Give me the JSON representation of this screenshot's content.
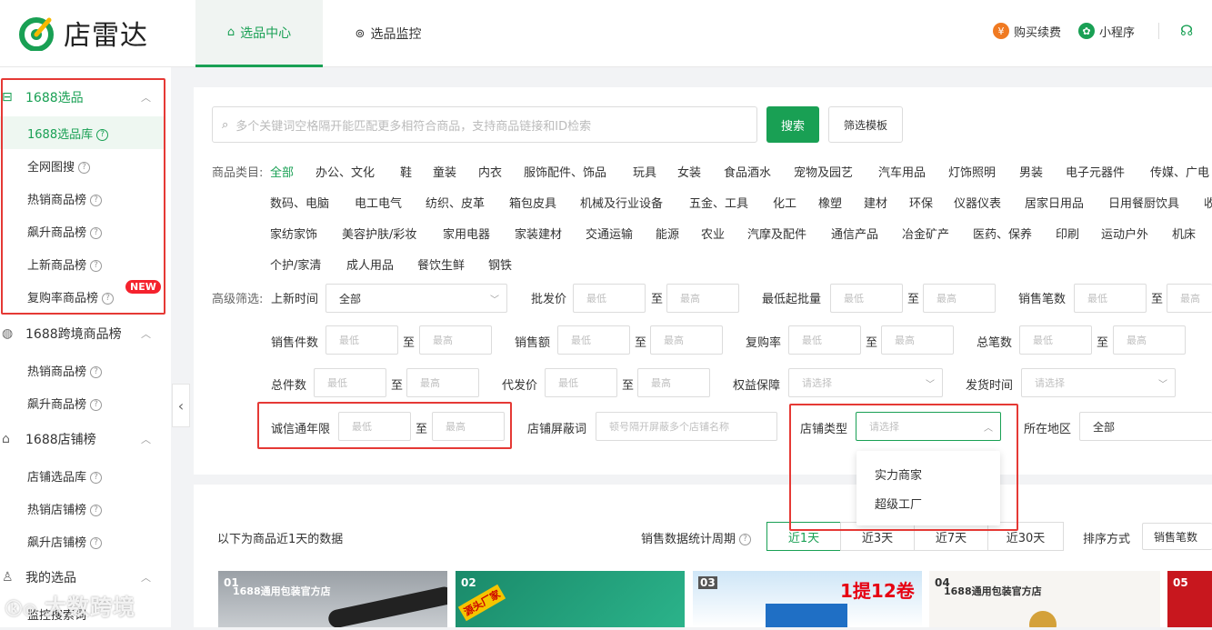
{
  "brand": {
    "name": "店雷达",
    "color": "#19a054"
  },
  "topnav": {
    "tab1": "选品中心",
    "tab2": "选品监控",
    "buy": "购买续费",
    "mini": "小程序"
  },
  "sidebar": {
    "g1": "1688选品",
    "g1_items": [
      "1688选品库",
      "全网图搜",
      "热销商品榜",
      "飙升商品榜",
      "上新商品榜",
      "复购率商品榜"
    ],
    "new_badge": "NEW",
    "g2": "1688跨境商品榜",
    "g2_items": [
      "热销商品榜",
      "飙升商品榜"
    ],
    "g3": "1688店铺榜",
    "g3_items": [
      "店铺选品库",
      "热销店铺榜",
      "飙升店铺榜"
    ],
    "g4": "我的选品",
    "g4_items": [
      "监控搜索词"
    ]
  },
  "search": {
    "placeholder": "多个关键词空格隔开能匹配更多相符合商品，支持商品链接和ID检索",
    "button": "搜索",
    "template": "筛选模板"
  },
  "categories": {
    "label": "商品类目:",
    "all": "全部",
    "row1": [
      "办公、文化",
      "鞋",
      "童装",
      "内衣",
      "服饰配件、饰品",
      "玩具",
      "女装",
      "食品酒水",
      "宠物及园艺",
      "汽车用品",
      "灯饰照明",
      "男装",
      "电子元器件",
      "传媒、广电"
    ],
    "row2": [
      "数码、电脑",
      "电工电气",
      "纺织、皮革",
      "箱包皮具",
      "机械及行业设备",
      "五金、工具",
      "化工",
      "橡塑",
      "建材",
      "环保",
      "仪器仪表",
      "居家日用品",
      "日用餐厨饮具",
      "收"
    ],
    "row3": [
      "家纺家饰",
      "美容护肤/彩妆",
      "家用电器",
      "家装建材",
      "交通运输",
      "能源",
      "农业",
      "汽摩及配件",
      "通信产品",
      "冶金矿产",
      "医药、保养",
      "印刷",
      "运动户外",
      "机床"
    ],
    "row4": [
      "个护/家清",
      "成人用品",
      "餐饮生鲜",
      "钢铁"
    ]
  },
  "filters": {
    "label": "高级筛选:",
    "to": "至",
    "min": "最低",
    "max": "最高",
    "all": "全部",
    "select": "请选择",
    "new_time": "上新时间",
    "wholesale_price": "批发价",
    "min_order": "最低起批量",
    "sales_count": "销售笔数",
    "sales_pieces": "销售件数",
    "sales_amount": "销售额",
    "repurchase": "复购率",
    "total_orders": "总笔数",
    "total_pieces": "总件数",
    "dropship_price": "代发价",
    "rights": "权益保障",
    "ship_time": "发货时间",
    "credit_years": "诚信通年限",
    "shop_block": "店铺屏蔽词",
    "shop_block_ph": "顿号隔开屏蔽多个店铺名称",
    "shop_type": "店铺类型",
    "region": "所在地区"
  },
  "shop_type_options": [
    "实力商家",
    "超级工厂"
  ],
  "results": {
    "note": "以下为商品近1天的数据",
    "period_label": "销售数据统计周期",
    "periods": [
      "近1天",
      "近3天",
      "近7天",
      "近30天"
    ],
    "sort_label": "排序方式",
    "sort_value": "销售笔数"
  },
  "cards": [
    {
      "rank": "01",
      "text": "1688通用包装官方店"
    },
    {
      "rank": "02",
      "text": "源头厂家"
    },
    {
      "rank": "03",
      "text": "1提12卷"
    },
    {
      "rank": "04",
      "text": "1688通用包装官方店"
    },
    {
      "rank": "05",
      "text": ""
    }
  ],
  "watermark": "大数跨境"
}
